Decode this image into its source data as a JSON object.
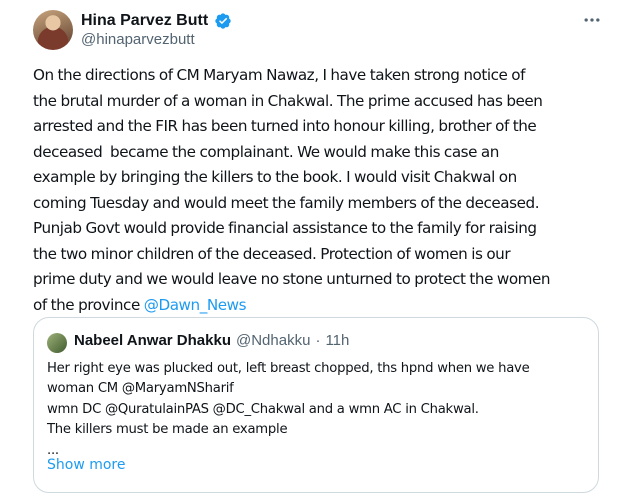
{
  "author": {
    "display_name": "Hina Parvez Butt",
    "handle": "@hinaparvezbutt"
  },
  "more_icon": "more-horizontal-icon",
  "tweet": {
    "text_lines": [
      "On the directions of CM Maryam Nawaz, I have taken strong notice of",
      "the brutal murder of a woman in Chakwal. The prime accused has been",
      "arrested and the FIR has been turned into honour killing, brother of the",
      "deceased  became the complainant. We would make this case an",
      "example by bringing the killers to the book. I would visit Chakwal on",
      "coming Tuesday and would meet the family members of the deceased.",
      "Punjab Govt would provide financial assistance to the family for raising",
      "the two minor children of the deceased. Protection of women is our",
      "prime duty and we would leave no stone unturned to protect the women",
      "of the province "
    ],
    "mention": "@Dawn_News"
  },
  "quote": {
    "display_name": "Nabeel Anwar Dhakku",
    "handle": "@Ndhakku",
    "separator": "·",
    "time": "11h",
    "lines": [
      "Her right eye was plucked out, left breast chopped, ths hpnd when we have",
      "woman CM @MaryamNSharif",
      "wmn DC @QuratulainPAS @DC_Chakwal and a wmn AC in Chakwal.",
      "The killers must be made an example",
      "..."
    ],
    "show_more": "Show more"
  },
  "colors": {
    "link": "#1d9bf0",
    "verified": "#1d9bf0",
    "muted": "#536471",
    "border": "#cfd9de"
  }
}
